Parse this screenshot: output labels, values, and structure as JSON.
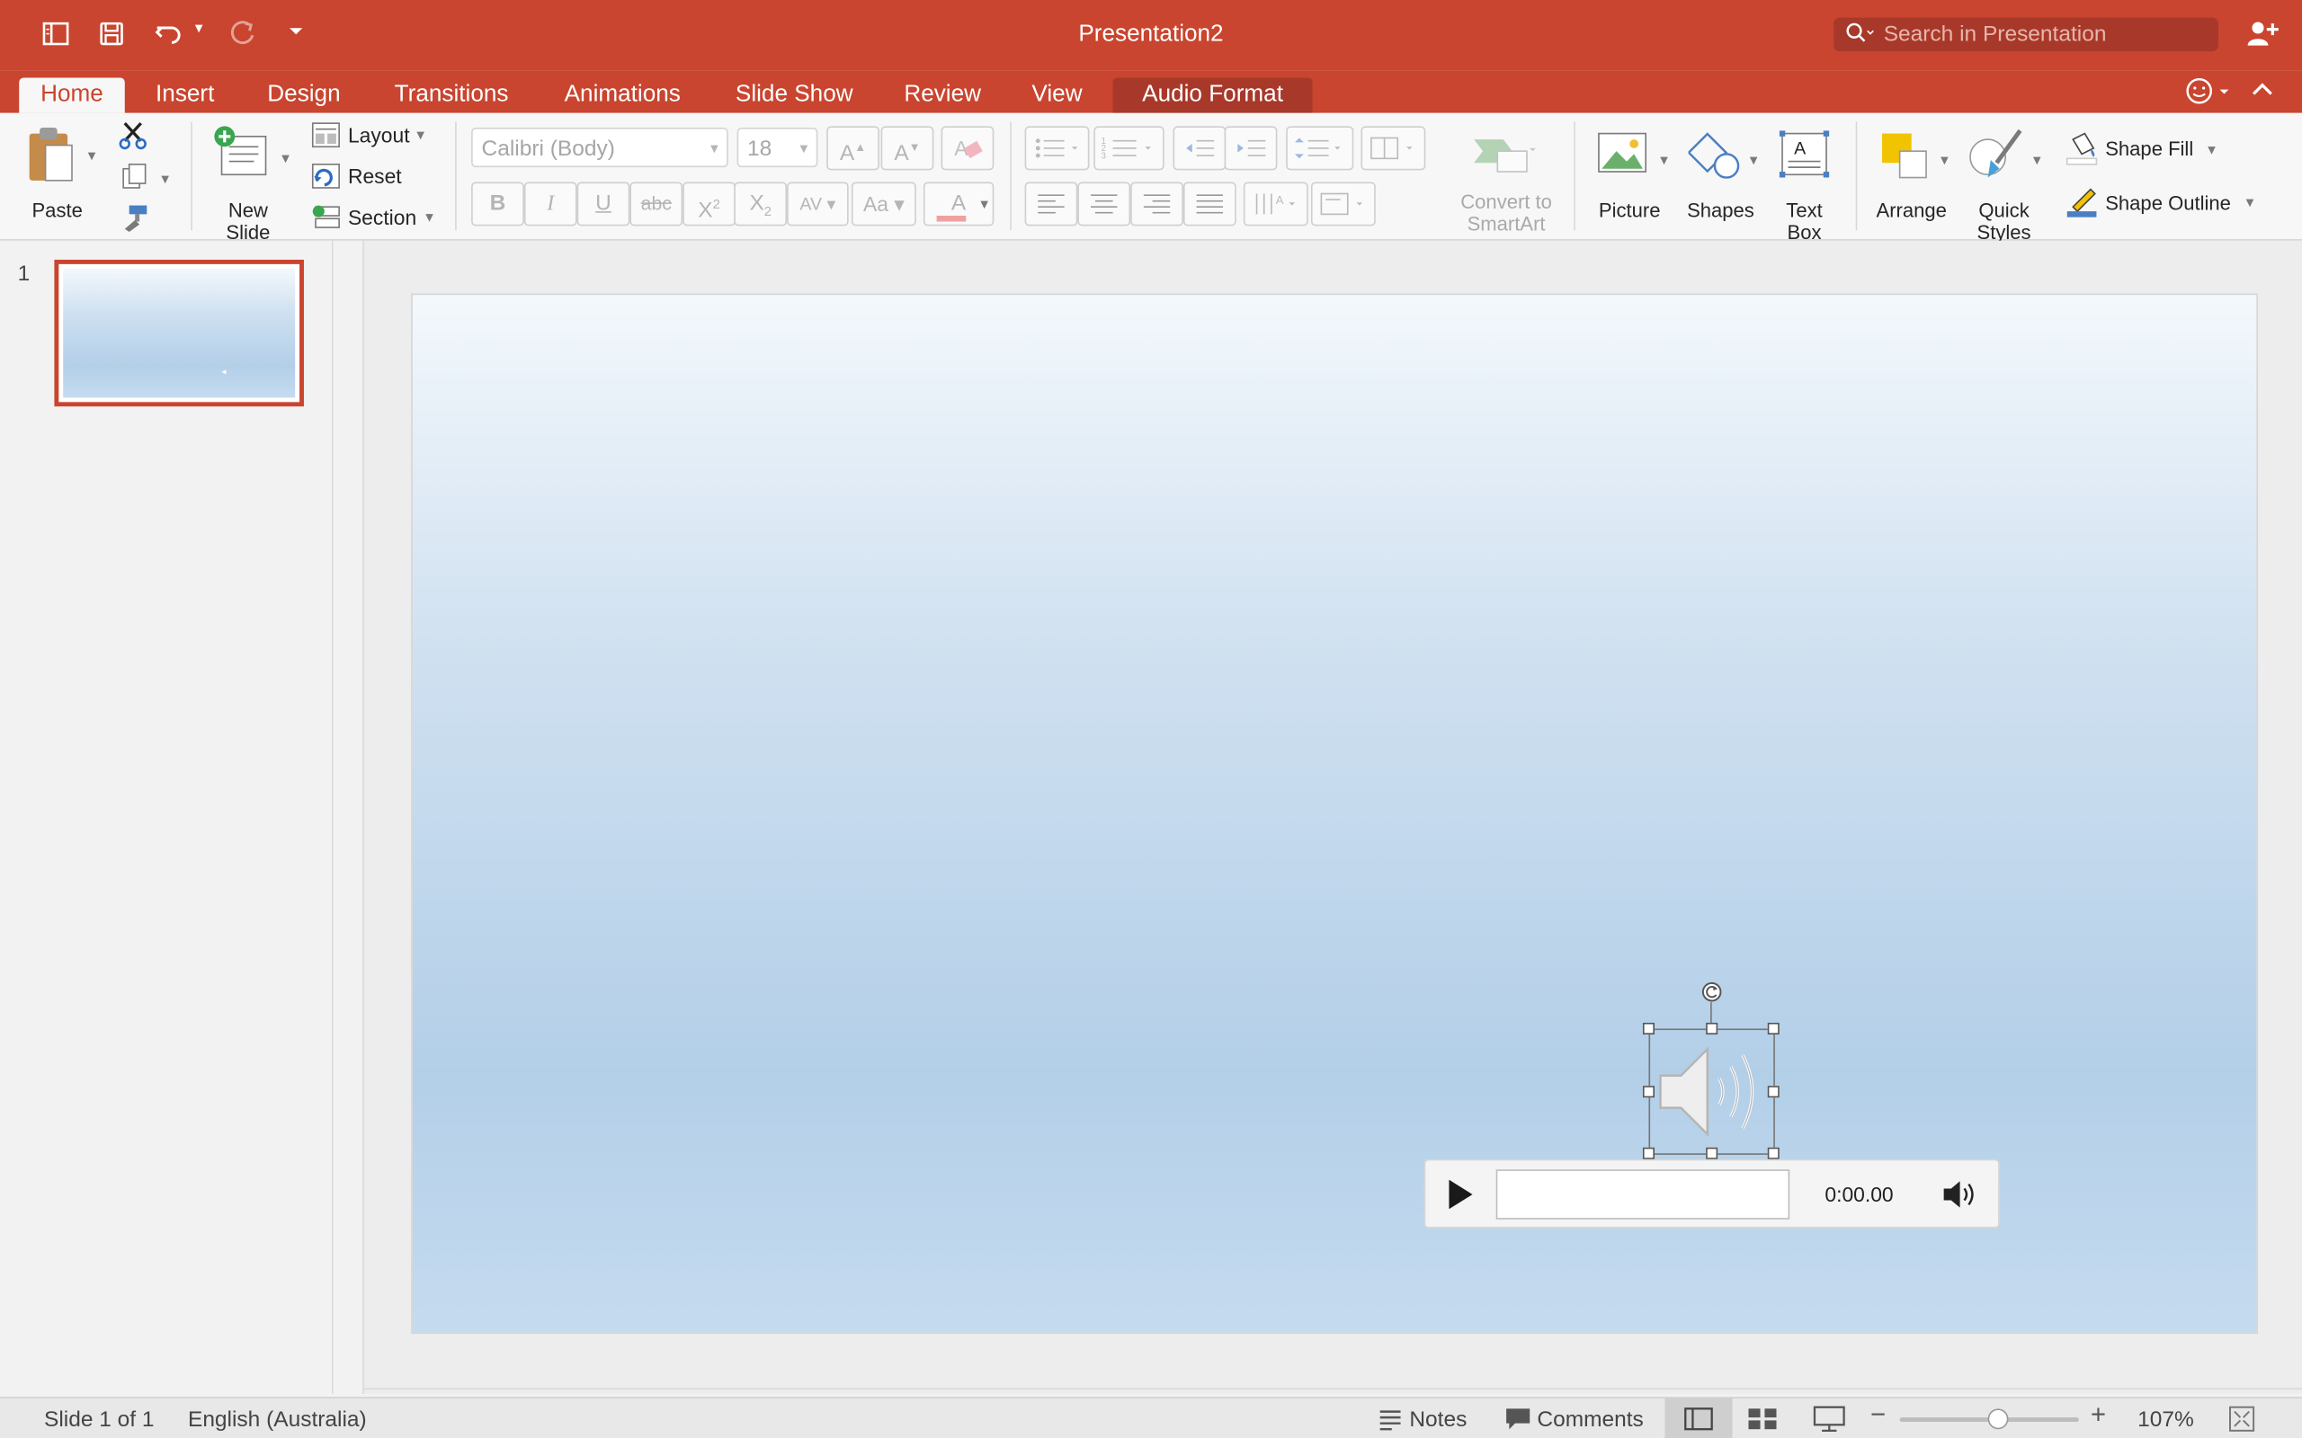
{
  "window": {
    "title": "Presentation2",
    "search_placeholder": "Search in Presentation"
  },
  "tabs": [
    {
      "label": "Home",
      "active": true
    },
    {
      "label": "Insert"
    },
    {
      "label": "Design"
    },
    {
      "label": "Transitions"
    },
    {
      "label": "Animations"
    },
    {
      "label": "Slide Show"
    },
    {
      "label": "Review"
    },
    {
      "label": "View"
    },
    {
      "label": "Audio Format",
      "contextual": true
    }
  ],
  "ribbon": {
    "paste": "Paste",
    "new_slide_1": "New",
    "new_slide_2": "Slide",
    "layout": "Layout",
    "reset": "Reset",
    "section": "Section",
    "font_name": "Calibri (Body)",
    "font_size": "18",
    "convert_1": "Convert to",
    "convert_2": "SmartArt",
    "picture": "Picture",
    "shapes": "Shapes",
    "textbox_1": "Text",
    "textbox_2": "Box",
    "arrange": "Arrange",
    "quick_styles_1": "Quick",
    "quick_styles_2": "Styles",
    "shape_fill": "Shape Fill",
    "shape_outline": "Shape Outline"
  },
  "thumbs": [
    {
      "number": "1"
    }
  ],
  "audio": {
    "time": "0:00.00"
  },
  "status": {
    "slide": "Slide 1 of 1",
    "language": "English (Australia)",
    "notes": "Notes",
    "comments": "Comments",
    "zoom": "107%",
    "zoom_fraction": 0.55
  },
  "colors": {
    "accent": "#c9452f",
    "accent_dark": "#a8392a"
  }
}
